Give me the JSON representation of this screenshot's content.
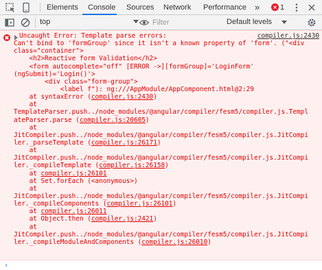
{
  "tabs": [
    {
      "label": "Elements",
      "active": false
    },
    {
      "label": "Console",
      "active": true
    },
    {
      "label": "Sources",
      "active": false
    },
    {
      "label": "Network",
      "active": false
    },
    {
      "label": "Performance",
      "active": false
    }
  ],
  "more_tabs_label": "»",
  "error_count": "1",
  "toolbar": {
    "context": "top",
    "filter_placeholder": "Filter",
    "levels": "Default levels"
  },
  "message": {
    "first_source": "compiler.js:2430",
    "lines": [
      {
        "text": "Uncaught Error: Template parse errors:",
        "link": "",
        "after": ""
      },
      {
        "text": "Can't bind to 'formGroup' since it isn't a known property of 'form'. (\"<div",
        "link": "",
        "after": ""
      },
      {
        "text": "class=\"container\">",
        "link": "",
        "after": ""
      },
      {
        "text": "    <h2>Reactive form Validation</h2>",
        "link": "",
        "after": ""
      },
      {
        "text": "    <form autocomplete=\"off\" [ERROR ->][formGroup]='LoginForm'",
        "link": "",
        "after": ""
      },
      {
        "text": "(ngSubmit)='Login()'>",
        "link": "",
        "after": ""
      },
      {
        "text": "        <div class=\"form-group\">",
        "link": "",
        "after": ""
      },
      {
        "text": "            <label f\"): ng:///AppModule/AppComponent.html@2:29",
        "link": "",
        "after": ""
      },
      {
        "text": "    at syntaxError (",
        "link": "compiler.js:2430",
        "after": ")"
      },
      {
        "text": "    at",
        "link": "",
        "after": ""
      },
      {
        "text": "TemplateParser.push../node_modules/@angular/compiler/fesm5/compiler.js.Templ",
        "link": "",
        "after": ""
      },
      {
        "text": "ateParser.parse (",
        "link": "compiler.js:20605",
        "after": ")"
      },
      {
        "text": "    at",
        "link": "",
        "after": ""
      },
      {
        "text": "JitCompiler.push../node_modules/@angular/compiler/fesm5/compiler.js.JitCompi",
        "link": "",
        "after": ""
      },
      {
        "text": "ler._parseTemplate (",
        "link": "compiler.js:26171",
        "after": ")"
      },
      {
        "text": "    at",
        "link": "",
        "after": ""
      },
      {
        "text": "JitCompiler.push../node_modules/@angular/compiler/fesm5/compiler.js.JitCompi",
        "link": "",
        "after": ""
      },
      {
        "text": "ler._compileTemplate (",
        "link": "compiler.js:26158",
        "after": ")"
      },
      {
        "text": "    at ",
        "link": "compiler.js:26101",
        "after": ""
      },
      {
        "text": "    at Set.forEach (<anonymous>)",
        "link": "",
        "after": ""
      },
      {
        "text": "    at",
        "link": "",
        "after": ""
      },
      {
        "text": "JitCompiler.push../node_modules/@angular/compiler/fesm5/compiler.js.JitCompi",
        "link": "",
        "after": ""
      },
      {
        "text": "ler._compileComponents (",
        "link": "compiler.js:26101",
        "after": ")"
      },
      {
        "text": "    at ",
        "link": "compiler.js:26011",
        "after": ""
      },
      {
        "text": "    at Object.then (",
        "link": "compiler.js:2421",
        "after": ")"
      },
      {
        "text": "    at",
        "link": "",
        "after": ""
      },
      {
        "text": "JitCompiler.push../node_modules/@angular/compiler/fesm5/compiler.js.JitCompi",
        "link": "",
        "after": ""
      },
      {
        "text": "ler._compileModuleAndComponents (",
        "link": "compiler.js:26010",
        "after": ")"
      }
    ]
  },
  "prompt_symbol": "›",
  "colors": {
    "error_text": "#e10000",
    "error_background": "#fff0f0",
    "active_tab_underline": "#1a73e8",
    "error_badge": "#e41e2a"
  },
  "icons": [
    "inspect-element-icon",
    "device-toolbar-icon",
    "more-tabs-icon",
    "error-badge-icon",
    "kebab-menu-icon",
    "close-icon",
    "sidebar-toggle-icon",
    "clear-console-icon",
    "eye-icon",
    "settings-gear-icon",
    "error-circle-icon",
    "expand-triangle-icon"
  ]
}
